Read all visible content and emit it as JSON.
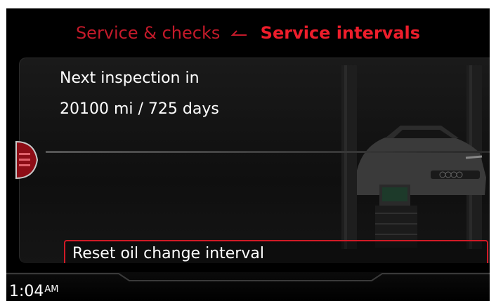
{
  "header": {
    "parent": "Service & checks",
    "separator_icon": "back-arrow-icon",
    "current": "Service intervals"
  },
  "inspection": {
    "label": "Next inspection in",
    "value": "20100 mi / 725 days"
  },
  "actions": {
    "reset_oil": "Reset oil change interval"
  },
  "status": {
    "time": "1:04",
    "ampm": "AM"
  },
  "colors": {
    "accent": "#ee1d2b",
    "breadcrumb_parent": "#c41a2a",
    "background": "#000000",
    "text": "#ffffff"
  }
}
